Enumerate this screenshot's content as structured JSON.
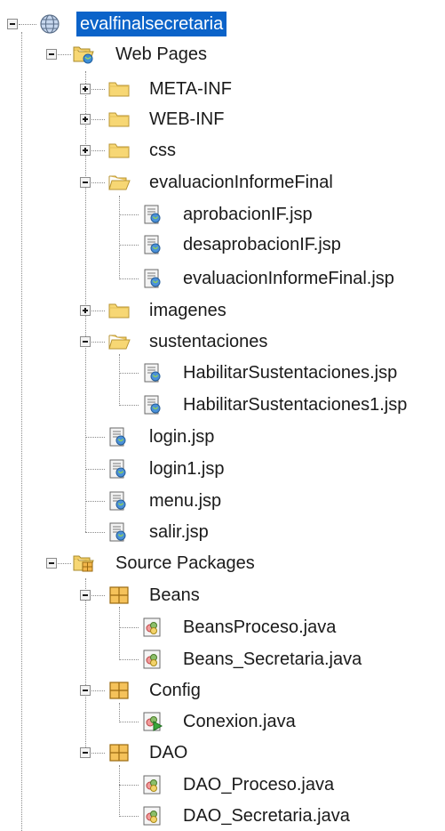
{
  "project": {
    "name": "evalfinalsecretaria",
    "children": [
      {
        "name": "Web Pages",
        "children": [
          {
            "name": "META-INF"
          },
          {
            "name": "WEB-INF"
          },
          {
            "name": "css"
          },
          {
            "name": "evaluacionInformeFinal",
            "children": [
              {
                "name": "aprobacionIF.jsp"
              },
              {
                "name": "desaprobacionIF.jsp"
              },
              {
                "name": "evaluacionInformeFinal.jsp"
              }
            ]
          },
          {
            "name": "imagenes"
          },
          {
            "name": "sustentaciones",
            "children": [
              {
                "name": "HabilitarSustentaciones.jsp"
              },
              {
                "name": "HabilitarSustentaciones1.jsp"
              }
            ]
          },
          {
            "name": "login.jsp"
          },
          {
            "name": "login1.jsp"
          },
          {
            "name": "menu.jsp"
          },
          {
            "name": "salir.jsp"
          }
        ]
      },
      {
        "name": "Source Packages",
        "children": [
          {
            "name": "Beans",
            "children": [
              {
                "name": "BeansProceso.java"
              },
              {
                "name": "Beans_Secretaria.java"
              }
            ]
          },
          {
            "name": "Config",
            "children": [
              {
                "name": "Conexion.java"
              }
            ]
          },
          {
            "name": "DAO",
            "children": [
              {
                "name": "DAO_Proceso.java"
              },
              {
                "name": "DAO_Secretaria.java"
              }
            ]
          }
        ]
      }
    ]
  },
  "colors": {
    "selection": "#0b63c9",
    "folder": "#f7d774",
    "package": "#f2b64a"
  },
  "icons": {
    "project": "globe-icon",
    "web_pages": "web-pages-folder-icon",
    "folder_closed": "folder-icon",
    "folder_open": "folder-open-icon",
    "jsp": "jsp-file-icon",
    "source_packages": "source-packages-folder-icon",
    "package": "package-icon",
    "java": "java-class-icon",
    "java_main": "java-main-class-icon"
  }
}
